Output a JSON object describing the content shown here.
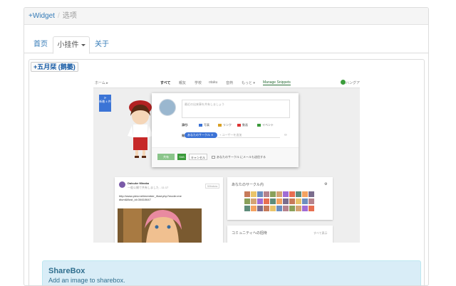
{
  "breadcrumb": {
    "root": "+Widget",
    "current": "选项"
  },
  "tabs": [
    {
      "label": "首页"
    },
    {
      "label": "小挂件"
    },
    {
      "label": "关于"
    }
  ],
  "panel": {
    "title": "+五月栞 (鹅萎)"
  },
  "preview": {
    "nav": {
      "home": "ホーム ▸",
      "tabs": [
        "すべて",
        "親友",
        "学校",
        "otaku",
        "音熱",
        "もっと ▾"
      ],
      "manage": "Manage Snippets",
      "hangouts": "ハングア"
    },
    "side_box": "新着 4 件",
    "dialog": {
      "placeholder": "最近の出来事を共有しましょう",
      "attach_label": "添付:",
      "attach_items": [
        "写真",
        "リンク",
        "動画",
        "イベント"
      ],
      "share_label": "発先:",
      "circle_pill": "あなたのサークル ✕",
      "add_people": "+ ユーザーを追加",
      "share_btn": "共有",
      "sharebox_btn": "ShB",
      "cancel_btn": "キャンセル",
      "email_note": "あなたのサークル にメールも送信する"
    },
    "post": {
      "author": "Daisuke Minaka",
      "meta": "一般公開で共有しました - 11:17",
      "follow": "Window",
      "link": "http://www.pixiv.net/member_illust.php?mode=medium&illust_id=34610647"
    },
    "circles": {
      "title": "あなたのサークル内"
    },
    "community": {
      "title": "コミュニティへの招待",
      "more": "すべて表示"
    }
  },
  "sharebox": {
    "title": "ShareBox",
    "description": "Add an image to sharebox."
  },
  "colors": {
    "link": "#337ab7",
    "info_bg": "#d9edf7",
    "info_text": "#31708f",
    "gplus_blue": "#3b74d6"
  }
}
